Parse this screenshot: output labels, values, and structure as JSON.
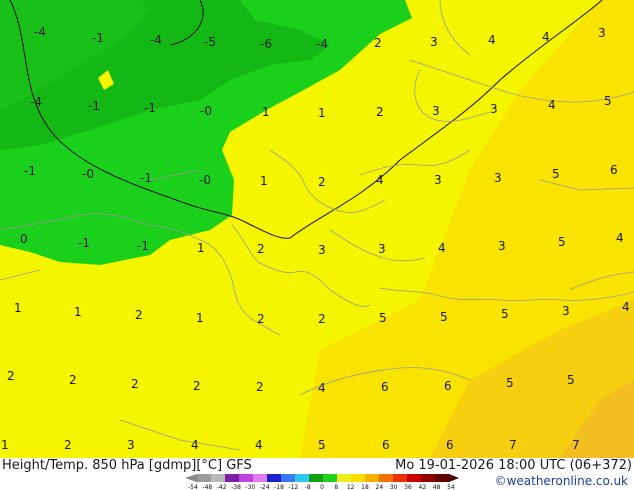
{
  "map": {
    "isotherm_labels": [
      {
        "text": "-4",
        "row": 0
      },
      {
        "text": "-1",
        "row": 0
      },
      {
        "text": "-4",
        "row": 0
      },
      {
        "text": "-5",
        "row": 0
      },
      {
        "text": "-6",
        "row": 0
      },
      {
        "text": "-4",
        "row": 0
      },
      {
        "text": "2",
        "row": 0
      },
      {
        "text": "3",
        "row": 0
      },
      {
        "text": "4",
        "row": 0
      },
      {
        "text": "4",
        "row": 0
      },
      {
        "text": "3",
        "row": 0
      },
      {
        "text": "-4",
        "row": 1
      },
      {
        "text": "-1",
        "row": 1
      },
      {
        "text": "-1",
        "row": 1
      },
      {
        "text": "-0",
        "row": 1
      },
      {
        "text": "1",
        "row": 1
      },
      {
        "text": "1",
        "row": 1
      },
      {
        "text": "2",
        "row": 1
      },
      {
        "text": "3",
        "row": 1
      },
      {
        "text": "3",
        "row": 1
      },
      {
        "text": "4",
        "row": 1
      },
      {
        "text": "5",
        "row": 1
      },
      {
        "text": "-1",
        "row": 2
      },
      {
        "text": "-0",
        "row": 2
      },
      {
        "text": "-1",
        "row": 2
      },
      {
        "text": "-0",
        "row": 2
      },
      {
        "text": "1",
        "row": 2
      },
      {
        "text": "2",
        "row": 2
      },
      {
        "text": "4",
        "row": 2
      },
      {
        "text": "3",
        "row": 2
      },
      {
        "text": "3",
        "row": 2
      },
      {
        "text": "5",
        "row": 2
      },
      {
        "text": "6",
        "row": 2
      },
      {
        "text": "0",
        "row": 3
      },
      {
        "text": "-1",
        "row": 3
      },
      {
        "text": "-1",
        "row": 3
      },
      {
        "text": "1",
        "row": 3
      },
      {
        "text": "2",
        "row": 3
      },
      {
        "text": "3",
        "row": 3
      },
      {
        "text": "3",
        "row": 3
      },
      {
        "text": "4",
        "row": 3
      },
      {
        "text": "3",
        "row": 3
      },
      {
        "text": "5",
        "row": 3
      },
      {
        "text": "4",
        "row": 3
      },
      {
        "text": "1",
        "row": 4
      },
      {
        "text": "1",
        "row": 4
      },
      {
        "text": "2",
        "row": 4
      },
      {
        "text": "1",
        "row": 4
      },
      {
        "text": "2",
        "row": 4
      },
      {
        "text": "2",
        "row": 4
      },
      {
        "text": "5",
        "row": 4
      },
      {
        "text": "5",
        "row": 4
      },
      {
        "text": "5",
        "row": 4
      },
      {
        "text": "3",
        "row": 4
      },
      {
        "text": "4",
        "row": 4
      },
      {
        "text": "2",
        "row": 5
      },
      {
        "text": "2",
        "row": 5
      },
      {
        "text": "2",
        "row": 5
      },
      {
        "text": "2",
        "row": 5
      },
      {
        "text": "2",
        "row": 5
      },
      {
        "text": "4",
        "row": 5
      },
      {
        "text": "6",
        "row": 5
      },
      {
        "text": "6",
        "row": 5
      },
      {
        "text": "5",
        "row": 5
      },
      {
        "text": "5",
        "row": 5
      },
      {
        "text": "1",
        "row": 6
      },
      {
        "text": "2",
        "row": 6
      },
      {
        "text": "3",
        "row": 6
      },
      {
        "text": "4",
        "row": 6
      },
      {
        "text": "4",
        "row": 6
      },
      {
        "text": "5",
        "row": 6
      },
      {
        "text": "6",
        "row": 6
      },
      {
        "text": "6",
        "row": 6
      },
      {
        "text": "7",
        "row": 6
      },
      {
        "text": "7",
        "row": 6
      }
    ]
  },
  "footer": {
    "title": "Height/Temp. 850 hPa [gdmp][°C] GFS",
    "datetime": "Mo 19-01-2026 18:00 UTC (06+372)",
    "credit": "©weatheronline.co.uk",
    "scale_ticks": [
      "-54",
      "-48",
      "-42",
      "-38",
      "-30",
      "-24",
      "-18",
      "-12",
      "-8",
      "0",
      "8",
      "12",
      "18",
      "24",
      "30",
      "36",
      "42",
      "48",
      "54"
    ],
    "scale_colors": [
      "#9b9b9b",
      "#b8b8b8",
      "#7a1fa8",
      "#c040e0",
      "#e07cf0",
      "#2020d0",
      "#3a7af0",
      "#30c8f0",
      "#10a010",
      "#20d020",
      "#f0f020",
      "#f8e000",
      "#f8b000",
      "#f07000",
      "#e83000",
      "#c80000",
      "#900000",
      "#600000"
    ]
  },
  "colors": {
    "green_dark": "#14b814",
    "green": "#1ad01a",
    "green_light": "#28dc28",
    "yellow": "#f5f500",
    "yellow_warm": "#f9e000",
    "orange": "#f5c020"
  }
}
